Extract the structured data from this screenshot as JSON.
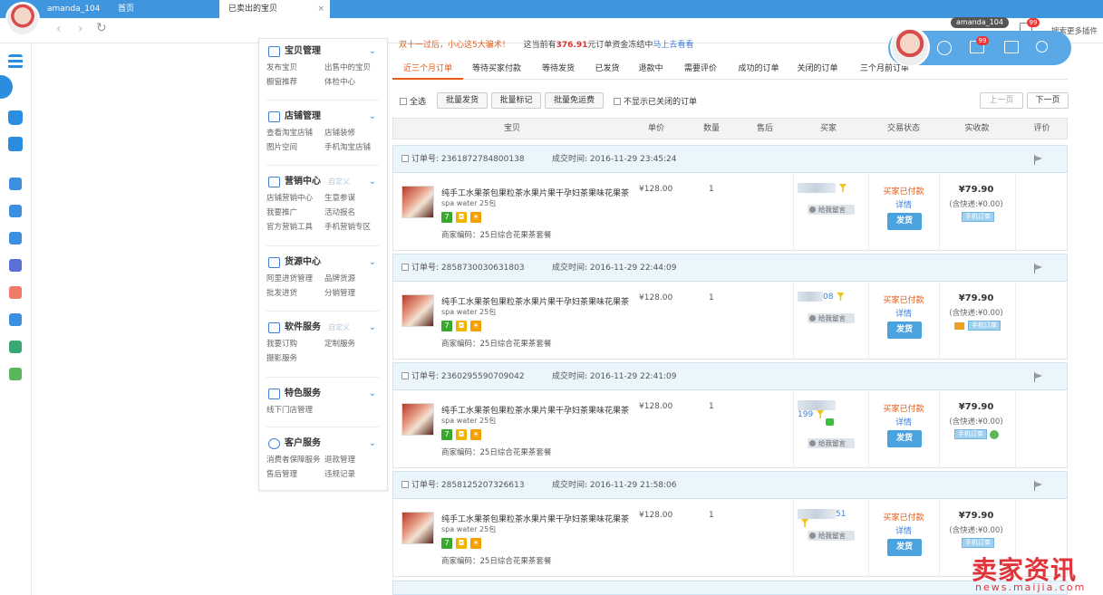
{
  "browser": {
    "user_tab": "amanda_104",
    "tabs": [
      {
        "label": "首页"
      },
      {
        "label": "已卖出的宝贝",
        "close": "×"
      }
    ]
  },
  "float_user": {
    "name": "amanda_104",
    "msg_count": "99",
    "extra": "搜索更多插件",
    "bar_msg_count": "99"
  },
  "notice": {
    "pre": "双十一过后，小心这5大骗术！",
    "mid_pre": "这当前有",
    "amount": "376.91",
    "mid_post": "元订单资金冻结中",
    "link": "马上去看看"
  },
  "menu": {
    "sections": [
      {
        "title": "宝贝管理",
        "custom": "",
        "links": [
          "发布宝贝",
          "出售中的宝贝",
          "橱窗推荐",
          "体检中心"
        ]
      },
      {
        "title": "店铺管理",
        "custom": "",
        "links": [
          "查看淘宝店铺",
          "店铺装修",
          "图片空间",
          "手机淘宝店铺"
        ]
      },
      {
        "title": "营销中心",
        "custom": "自定义",
        "links": [
          "店铺营销中心",
          "生意参谋",
          "我要推广",
          "活动报名",
          "官方营销工具",
          "手机营销专区"
        ]
      },
      {
        "title": "货源中心",
        "custom": "",
        "links": [
          "阿里进货管理",
          "品牌货源",
          "批发进货",
          "分销管理"
        ]
      },
      {
        "title": "软件服务",
        "custom": "自定义",
        "links": [
          "我要订购",
          "定制服务",
          "摄影服务"
        ]
      },
      {
        "title": "特色服务",
        "custom": "",
        "links": [
          "线下门店管理"
        ]
      },
      {
        "title": "客户服务",
        "custom": "",
        "links": [
          "消费者保障服务",
          "退款管理",
          "售后管理",
          "违规记录"
        ]
      }
    ]
  },
  "filter_tabs": [
    "近三个月订单",
    "等待买家付款",
    "等待发货",
    "已发货",
    "退款中",
    "需要评价",
    "成功的订单",
    "关闭的订单",
    "三个月前订单"
  ],
  "toolbar": {
    "select_all": "全选",
    "batch_ship": "批量发货",
    "batch_mark": "批量标记",
    "batch_free": "批量免运费",
    "hide_closed": "不显示已关闭的订单",
    "prev": "上一页",
    "next": "下一页"
  },
  "table_headers": [
    "宝贝",
    "单价",
    "数量",
    "售后",
    "买家",
    "交易状态",
    "实收款",
    "评价"
  ],
  "orders": [
    {
      "order_label": "订单号:",
      "order_no": "2361872784800138",
      "time_label": "成交时间:",
      "time": "2016-11-29 23:45:24",
      "title": "纯手工水果茶包果粒茶水果片果干孕妇茶果味花果茶",
      "subtitle": "spa water 25包",
      "sku": "商家编码：25日综合花果茶套餐",
      "price": "¥128.00",
      "qty": "1",
      "buyer_suffix": "",
      "message": "给我留言",
      "status": "买家已付款",
      "detail": "详情",
      "ship": "发货",
      "amount": "¥79.90",
      "shipping": "(含快递:¥0.00)",
      "mobile": "手机订单"
    },
    {
      "order_label": "订单号:",
      "order_no": "2858730030631803",
      "time_label": "成交时间:",
      "time": "2016-11-29 22:44:09",
      "title": "纯手工水果茶包果粒茶水果片果干孕妇茶果味花果茶",
      "subtitle": "spa water 25包",
      "sku": "商家编码：25日综合花果茶套餐",
      "price": "¥128.00",
      "qty": "1",
      "buyer_suffix": "08",
      "message": "给我留言",
      "status": "买家已付款",
      "detail": "详情",
      "ship": "发货",
      "amount": "¥79.90",
      "shipping": "(含快递:¥0.00)",
      "mobile": "手机订单"
    },
    {
      "order_label": "订单号:",
      "order_no": "2360295590709042",
      "time_label": "成交时间:",
      "time": "2016-11-29 22:41:09",
      "title": "纯手工水果茶包果粒茶水果片果干孕妇茶果味花果茶",
      "subtitle": "spa water 25包",
      "sku": "商家编码：25日综合花果茶套餐",
      "price": "¥128.00",
      "qty": "1",
      "buyer_suffix": "199",
      "message": "给我留言",
      "status": "买家已付款",
      "detail": "详情",
      "ship": "发货",
      "amount": "¥79.90",
      "shipping": "(含快递:¥0.00)",
      "mobile": "手机订单"
    },
    {
      "order_label": "订单号:",
      "order_no": "2858125207326613",
      "time_label": "成交时间:",
      "time": "2016-11-29 21:58:06",
      "title": "纯手工水果茶包果粒茶水果片果干孕妇茶果味花果茶",
      "subtitle": "spa water 25包",
      "sku": "商家编码：25日综合花果茶套餐",
      "price": "¥128.00",
      "qty": "1",
      "buyer_suffix": "51",
      "message": "给我留言",
      "status": "买家已付款",
      "detail": "详情",
      "ship": "发货",
      "amount": "¥79.90",
      "shipping": "(含快递:¥0.00)",
      "mobile": "手机订单"
    }
  ],
  "watermark": {
    "cn": "卖家资讯",
    "url": "news.maijia.com"
  },
  "colors": {
    "accent": "#e35a19",
    "blue": "#3f96de",
    "link": "#3f7fd8"
  }
}
